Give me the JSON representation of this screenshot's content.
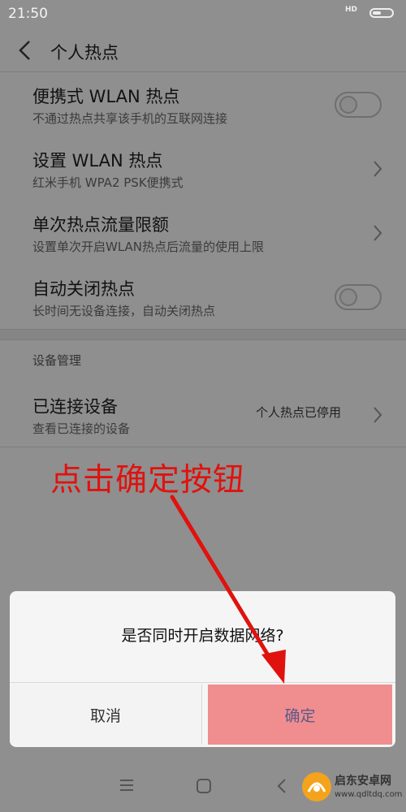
{
  "status_bar": {
    "time": "21:50",
    "network": "HD"
  },
  "header": {
    "title": "个人热点"
  },
  "settings": [
    {
      "title": "便携式 WLAN 热点",
      "subtitle": "不通过热点共享该手机的互联网连接"
    },
    {
      "title": "设置 WLAN 热点",
      "subtitle": "红米手机 WPA2 PSK便携式"
    },
    {
      "title": "单次热点流量限额",
      "subtitle": "设置单次开启WLAN热点后流量的使用上限"
    },
    {
      "title": "自动关闭热点",
      "subtitle": "长时间无设备连接，自动关闭热点"
    }
  ],
  "device_section": {
    "title": "设备管理",
    "connected": {
      "title": "已连接设备",
      "subtitle": "查看已连接的设备",
      "value": "个人热点已停用"
    }
  },
  "annotation": {
    "text": "点击确定按钮",
    "color": "#e0120e"
  },
  "dialog": {
    "message": "是否同时开启数据网络?",
    "cancel_label": "取消",
    "confirm_label": "确定"
  },
  "watermark": {
    "name": "启东安卓网",
    "url": "www.qdltdq.com"
  },
  "colors": {
    "confirm_highlight": "#f08d8f",
    "dim_background": "#8f8f8f"
  }
}
